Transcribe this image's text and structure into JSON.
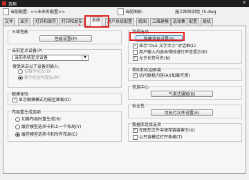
{
  "window": {
    "title": "选项"
  },
  "info": {
    "config_label": "当前配置:",
    "config_value": "<<未命名配置>>",
    "drawing_label": "当前图形:",
    "drawing_value": "施工图培训用_t5.dwg"
  },
  "tabs": [
    "文件",
    "显示",
    "打开和保存",
    "打印和发布",
    "系统",
    "用户系统配置",
    "绘图",
    "三维建模",
    "选择集",
    "配置",
    "联机"
  ],
  "annotations": {
    "step1": "1.",
    "step2": "2."
  },
  "left": {
    "perf": {
      "title": "三维性能",
      "button": "性能设置(P)"
    },
    "pointing": {
      "title": "当前定点设备(P)",
      "select": "当前系统定点设备",
      "accept_label": "接受来自以下设备的输入:",
      "opt_digitizer": "仅数字化仪(D)",
      "opt_both": "数字化仪和鼠标(M)"
    },
    "touch": {
      "title": "触摸体验",
      "check": "显示触摸模式功能区面板(D)"
    },
    "layout_regen": {
      "title": "布局重生成选项",
      "opt1": "切换布局时重生成(R)",
      "opt2": "缓存模型选项卡和上一个布局(Y)",
      "opt3": "缓存模型选项卡和所有布局(C)"
    }
  },
  "right": {
    "general": {
      "title": "常规选项",
      "button": "隐藏消息设置(S)",
      "check1": "显示“OLE 文字大小”对话框(L)",
      "check2": "用户输入内容出错时进行声音提示(B)",
      "check3": "允许长符号名(N)"
    },
    "help": {
      "title": "帮助和欢迎屏幕",
      "check": "访问联机内容(A)(如果可用)"
    },
    "info_center": {
      "title": "信息中心",
      "button": "气泡式通知(B)"
    },
    "security": {
      "title": "安全性",
      "button": "可执行文件设置(E)"
    },
    "db": {
      "title": "数据库连接选项",
      "check1": "在图形文件中保存链接索引(X)",
      "check2": "以只读模式打开表格(T)"
    }
  }
}
